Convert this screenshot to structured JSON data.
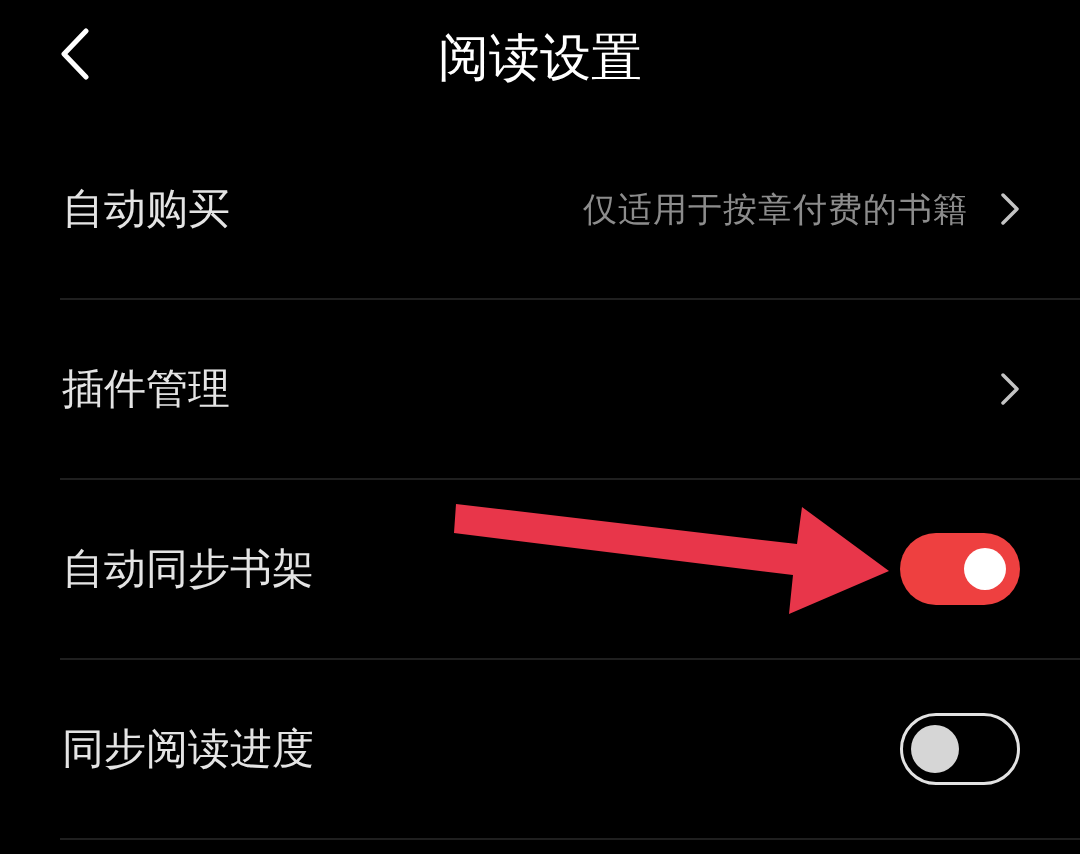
{
  "header": {
    "title": "阅读设置"
  },
  "rows": [
    {
      "kind": "link",
      "label": "自动购买",
      "value": "仅适用于按章付费的书籍",
      "pointed_by_arrow": false
    },
    {
      "kind": "link",
      "label": "插件管理",
      "pointed_by_arrow": false
    },
    {
      "kind": "toggle",
      "label": "自动同步书架",
      "on": true,
      "pointed_by_arrow": true
    },
    {
      "kind": "toggle",
      "label": "同步阅读进度",
      "on": false,
      "pointed_by_arrow": false
    }
  ]
}
